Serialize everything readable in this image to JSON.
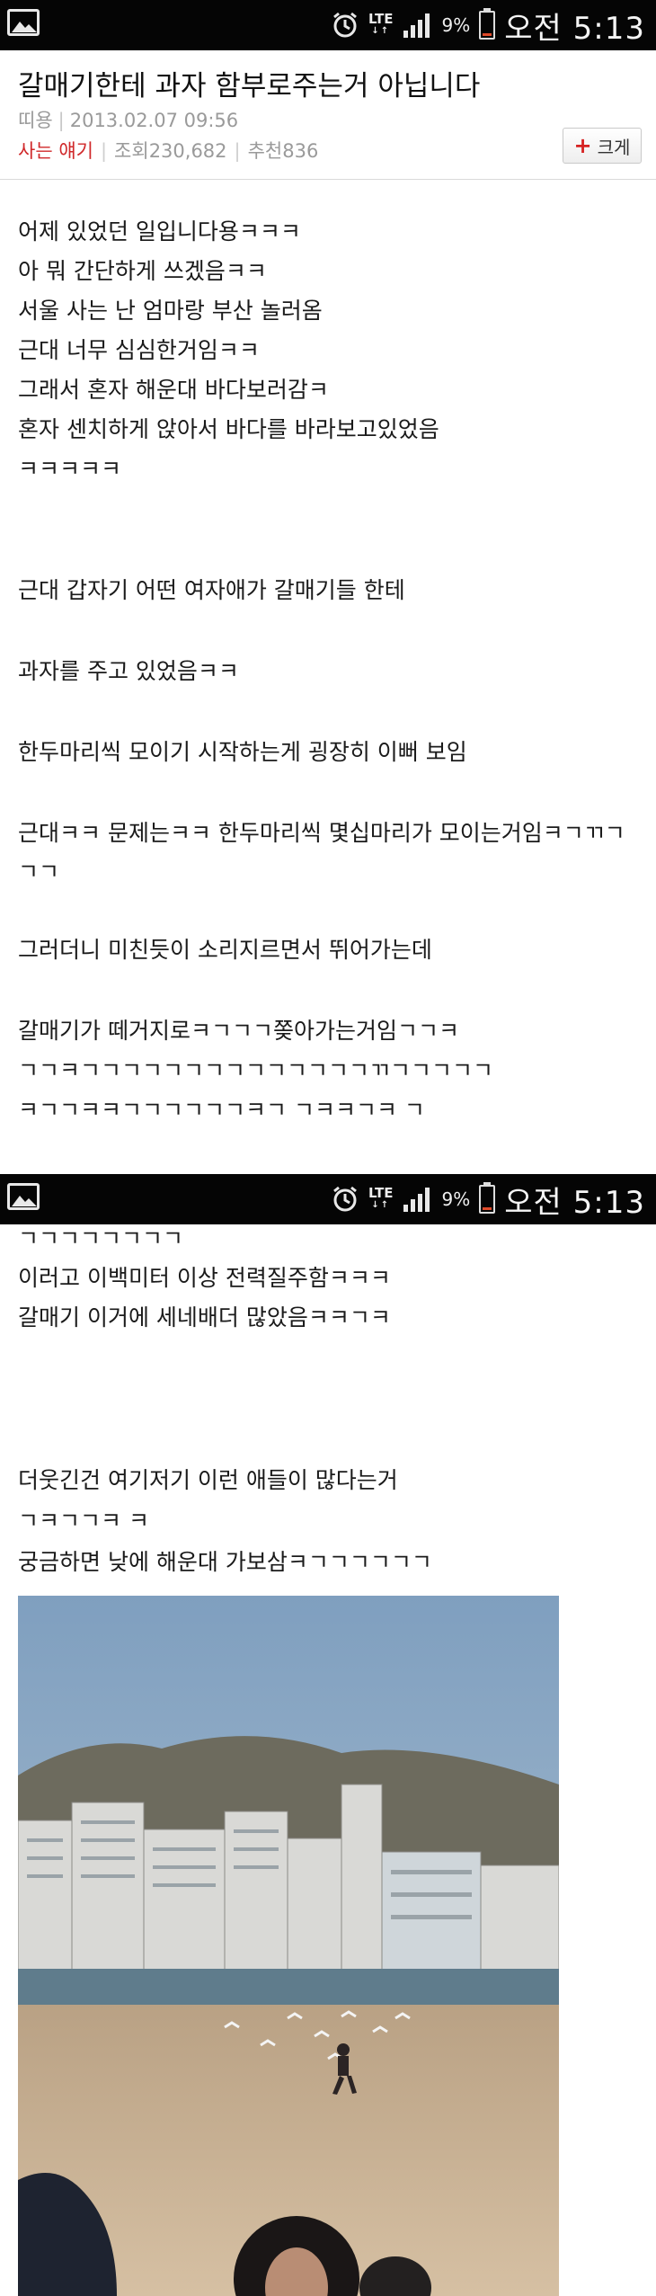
{
  "status_bar": {
    "network": "LTE",
    "battery": "9%",
    "time": "오전 5:13",
    "icons": [
      "gallery-icon",
      "alarm-icon",
      "lte-icon",
      "signal-icon",
      "battery-icon"
    ],
    "battery_color": "#e04a2a"
  },
  "post": {
    "title": "갈매기한테 과자 함부로주는거 아닙니다",
    "author": "띠용",
    "date": "2013.02.07 09:56",
    "category": "사는 얘기",
    "views_label": "조회",
    "views": "230,682",
    "recommend_label": "추천",
    "recommend": "836",
    "enlarge_label": "크게",
    "category_color": "#d0282a"
  },
  "lines": [
    "어제 있었던 일입니다용ㅋㅋㅋ",
    "아 뭐 간단하게 쓰겠음ㅋㅋ",
    "서울 사는 난 엄마랑 부산 놀러옴",
    "근대 너무 심심한거임ㅋㅋ",
    "그래서 혼자 해운대 바다보러감ㅋ",
    "혼자 센치하게 앉아서 바다를 바라보고있었음",
    "ㅋㅋㅋㅋㅋ",
    "근대 갑자기 어떤 여자애가 갈매기들 한테",
    "과자를 주고 있었음ㅋㅋ",
    "한두마리씩 모이기 시작하는게 굉장히 이뻐 보임",
    "근대ㅋㅋ 문제는ㅋㅋ 한두마리씩 몇십마리가 모이는거임ㅋㄱㄲㄱ",
    "ㄱㄱ",
    "그러더니 미친듯이 소리지르면서 뛰어가는데",
    "갈매기가 떼거지로ㅋㄱㄱㄱ쫒아가는거임ㄱㄱㅋ",
    "ㄱㄱㅋㄱㄱㄱㄱㄱㄱㄱㄱㄱㄱㄱㄱㄱㄱㄲㄱㄱㄱㄱㄱ",
    "ㅋㄱㄱㅋㅋㄱㄱㄱㄱㄱㄱㅋㄱ ㄱㅋㅋㄱㅋ ㄱ",
    "ㄱㄱㄱㄱㄱㄱㄱㄱ",
    "이러고 이백미터 이상 전력질주함ㅋㅋㅋ",
    "갈매기 이거에 세네배더 많았음ㅋㅋㄱㅋ",
    "더웃긴건 여기저기 이런 애들이 많다는거",
    "ㄱㅋㄱㄱㅋ ㅋ",
    "궁금하면 낮에 해운대 가보삼ㅋㄱㄱㄱㄱㄱㄱ"
  ]
}
